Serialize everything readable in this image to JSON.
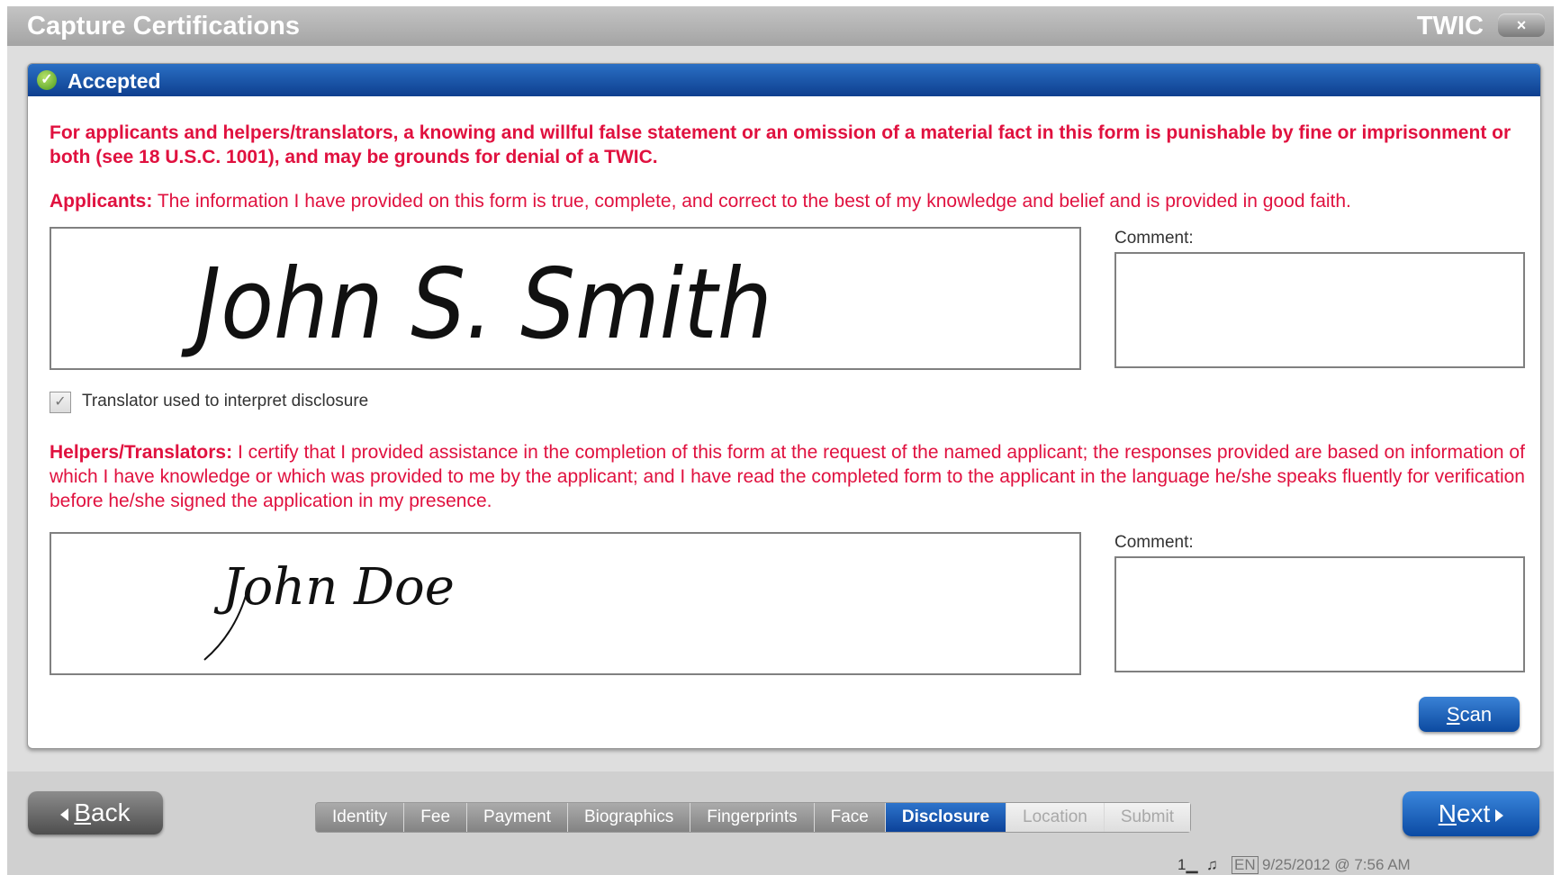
{
  "window": {
    "title": "Capture Certifications",
    "app_name": "TWIC",
    "close_label": "×"
  },
  "panel": {
    "status": "Accepted",
    "warning": "For applicants and helpers/translators, a knowing and willful false statement or an omission of a material fact in this form is punishable by fine or imprisonment or both (see 18 U.S.C. 1001), and may be grounds for denial of a TWIC.",
    "applicants": {
      "label": "Applicants:",
      "text": "The information I have provided on this form is true, complete, and correct to the best of my knowledge and belief and is provided in good faith.",
      "signature": "John S. Smith",
      "comment_label": "Comment:",
      "comment_value": ""
    },
    "translator_checkbox": {
      "label": "Translator used to interpret disclosure",
      "checked": true,
      "mark": "✓"
    },
    "helpers": {
      "label": "Helpers/Translators:",
      "text": "I certify that I provided assistance in the completion of this form at the request of the named applicant; the responses provided are based on information of which I have knowledge or which was provided to me by the applicant; and I have read the completed form to the applicant in the language he/she speaks fluently for verification before he/she signed the application in my presence.",
      "signature": "John Doe",
      "comment_label": "Comment:",
      "comment_value": ""
    },
    "scan_label": "Scan"
  },
  "footer": {
    "back_label": "Back",
    "next_label": "Next",
    "steps": [
      {
        "label": "Identity",
        "state": "done"
      },
      {
        "label": "Fee",
        "state": "done"
      },
      {
        "label": "Payment",
        "state": "done"
      },
      {
        "label": "Biographics",
        "state": "done"
      },
      {
        "label": "Fingerprints",
        "state": "done"
      },
      {
        "label": "Face",
        "state": "done"
      },
      {
        "label": "Disclosure",
        "state": "active"
      },
      {
        "label": "Location",
        "state": "disabled"
      },
      {
        "label": "Submit",
        "state": "disabled"
      }
    ]
  },
  "statusbar": {
    "queue_count": "1",
    "language": "EN",
    "datetime": "9/25/2012 @ 7:56 AM"
  },
  "colors": {
    "accent_blue": "#0e3f8f",
    "warning_red": "#e0113f",
    "accepted_green": "#4a9a1c"
  }
}
